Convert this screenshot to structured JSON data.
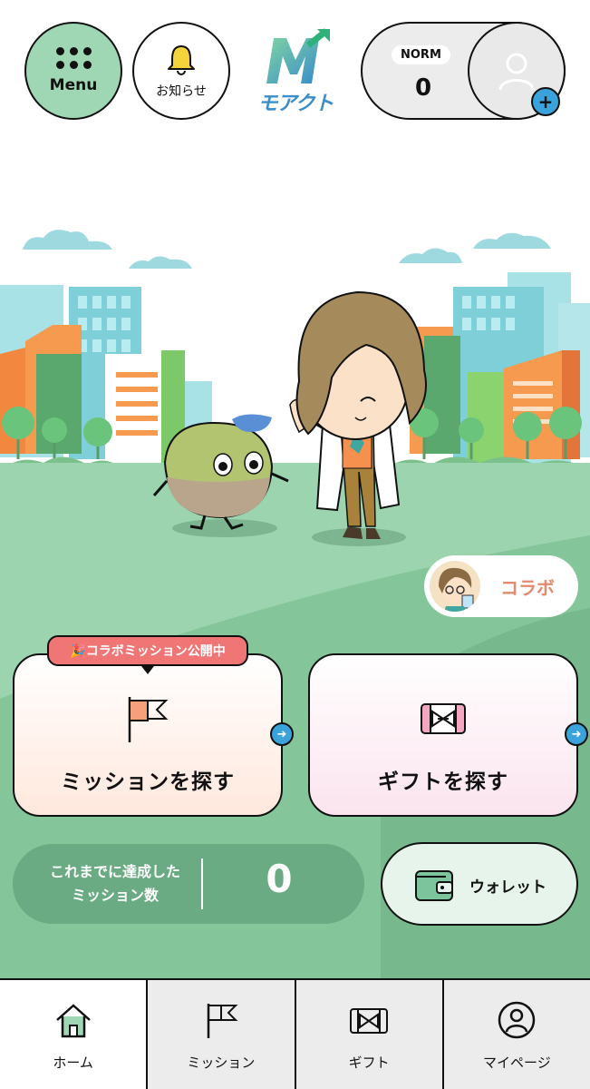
{
  "header": {
    "menu_label": "Menu",
    "notice_label": "お知らせ",
    "logo_text": "モアクト",
    "rank_label": "NORM",
    "points_value": "0",
    "add_badge": "+"
  },
  "collab_button_label": "コラボ",
  "mission_banner": "🎉コラボミッション公開中",
  "cards": {
    "mission_label": "ミッションを探す",
    "gift_label": "ギフトを探す"
  },
  "stats": {
    "label_line1": "これまでに達成した",
    "label_line2": "ミッション数",
    "value": "0"
  },
  "wallet_label": "ウォレット",
  "nav": [
    {
      "label": "ホーム",
      "icon": "home-icon"
    },
    {
      "label": "ミッション",
      "icon": "flag-icon"
    },
    {
      "label": "ギフト",
      "icon": "gift-icon"
    },
    {
      "label": "マイページ",
      "icon": "user-icon"
    }
  ],
  "colors": {
    "brand_green": "#9fd6b4",
    "accent_blue": "#3aa3dc",
    "collab_pink": "#f07575",
    "grass": "#8fcba4"
  }
}
